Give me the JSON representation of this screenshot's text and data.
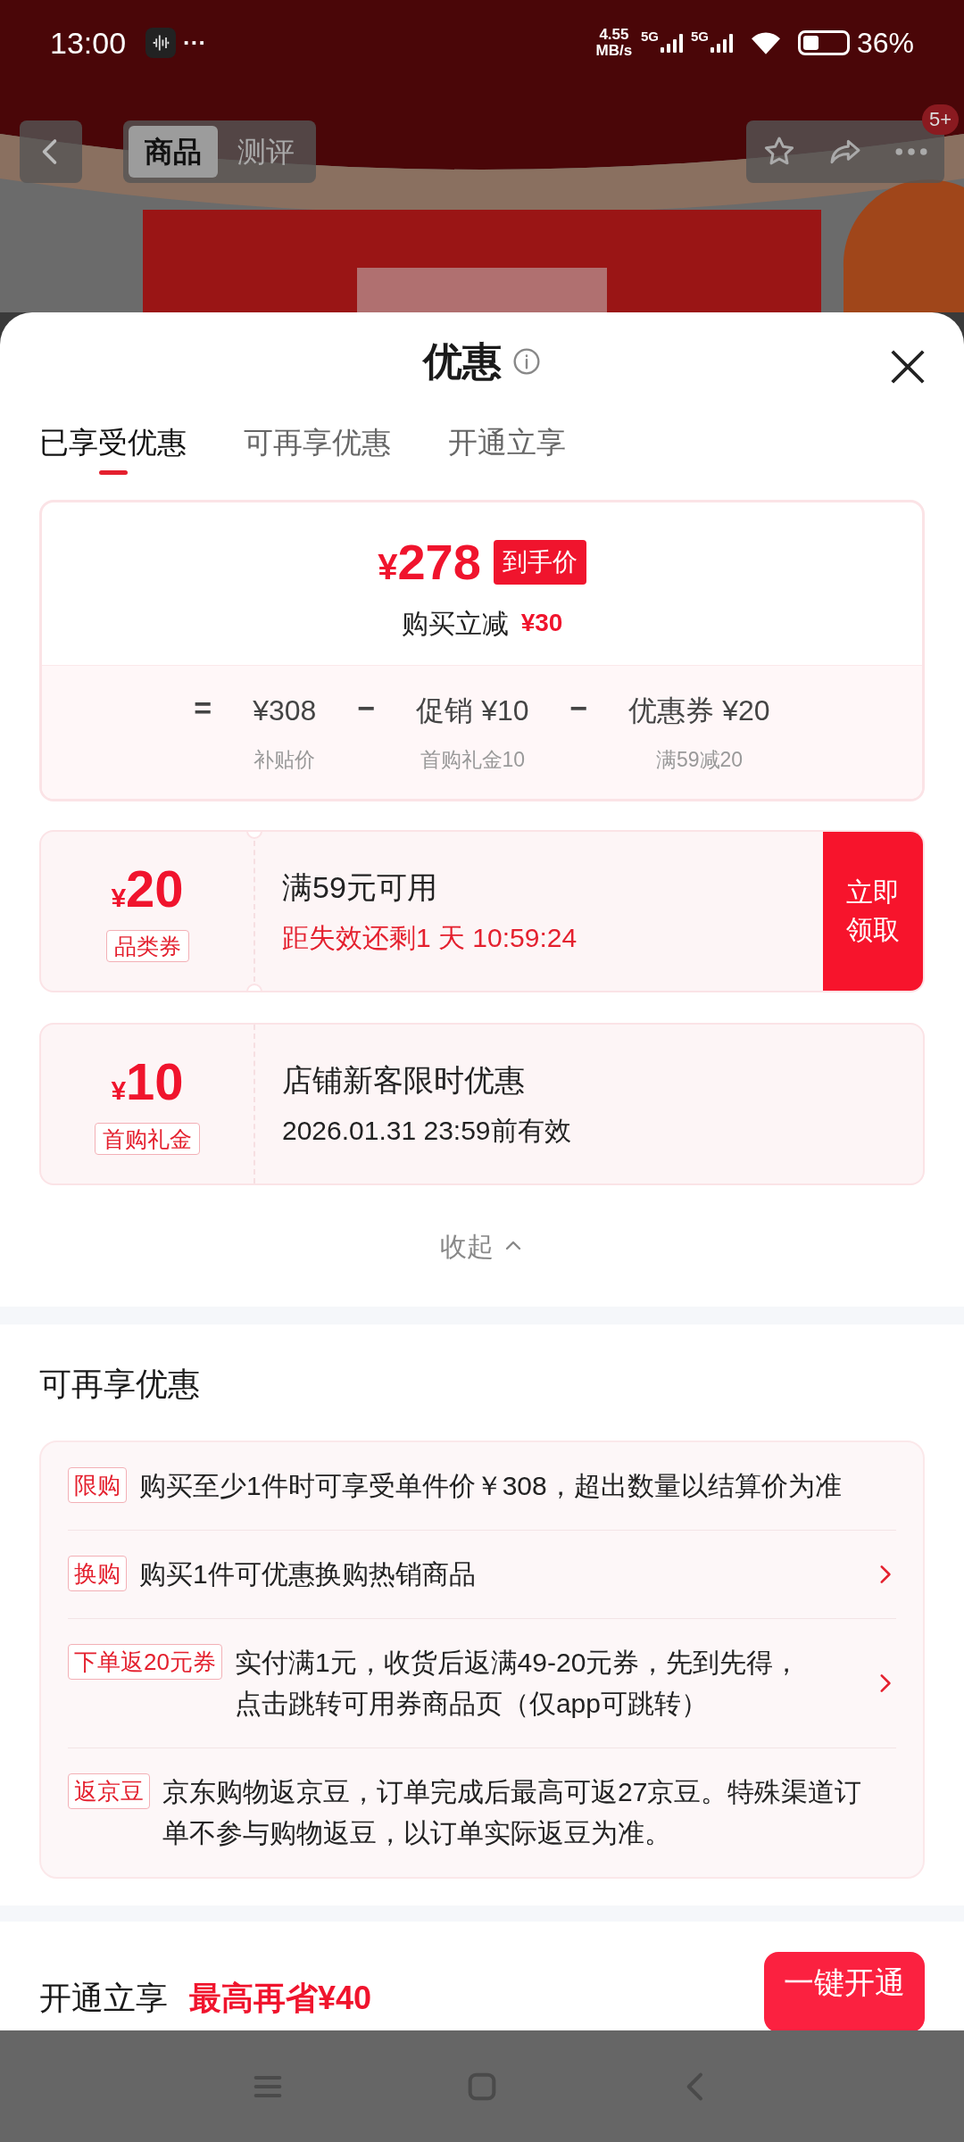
{
  "status_bar": {
    "time": "13:00",
    "more": "···",
    "speed": "4.55 MB/s",
    "sim1": "5G",
    "sim2": "5G",
    "battery": "36%"
  },
  "top_nav": {
    "tabs": [
      {
        "label": "商品",
        "selected": true
      },
      {
        "label": "测评",
        "selected": false
      }
    ],
    "badge": "5+"
  },
  "sheet": {
    "title": "优惠",
    "tabs": [
      {
        "label": "已享受优惠",
        "selected": true
      },
      {
        "label": "可再享优惠",
        "selected": false
      },
      {
        "label": "开通立享",
        "selected": false
      }
    ],
    "summary": {
      "currency": "¥",
      "price": "278",
      "price_tag": "到手价",
      "saving_label": "购买立减",
      "saving": "¥30",
      "formula": [
        {
          "kind": "operator",
          "text": "="
        },
        {
          "kind": "term",
          "text": "¥308",
          "note": "补贴价"
        },
        {
          "kind": "operator",
          "text": "−"
        },
        {
          "kind": "term",
          "text": "促销 ¥10",
          "note": "首购礼金10"
        },
        {
          "kind": "operator",
          "text": "−"
        },
        {
          "kind": "term",
          "text": "优惠券 ¥20",
          "note": "满59减20"
        }
      ]
    },
    "coupons": [
      {
        "currency": "¥",
        "amount": "20",
        "tag": "品类券",
        "title": "满59元可用",
        "detail": "距失效还剩1 天 10:59:24",
        "urgent": true,
        "action": "立即领取",
        "notched": true
      },
      {
        "currency": "¥",
        "amount": "10",
        "tag": "首购礼金",
        "title": "店铺新客限时优惠",
        "detail": "2026.01.31 23:59前有效",
        "urgent": false,
        "notched": false
      }
    ],
    "collapse": "收起",
    "more_section": {
      "title": "可再享优惠",
      "items": [
        {
          "tag": "限购",
          "text": "购买至少1件时可享受单件价￥308，超出数量以结算价为准",
          "link": false
        },
        {
          "tag": "换购",
          "text": "购买1件可优惠换购热销商品",
          "link": true
        },
        {
          "tag": "下单返20元券",
          "text": "实付满1元，收货后返满49-20元券，先到先得，点击跳转可用券商品页（仅app可跳转）",
          "link": true
        },
        {
          "tag": "返京豆",
          "text": "京东购物返京豆，订单完成后最高可返27京豆。特殊渠道订单不参与购物返豆，以订单实际返豆为准。",
          "link": false
        }
      ]
    },
    "membership": {
      "title": "开通立享",
      "highlight": "最高再省¥40",
      "button": "一键开通"
    }
  }
}
